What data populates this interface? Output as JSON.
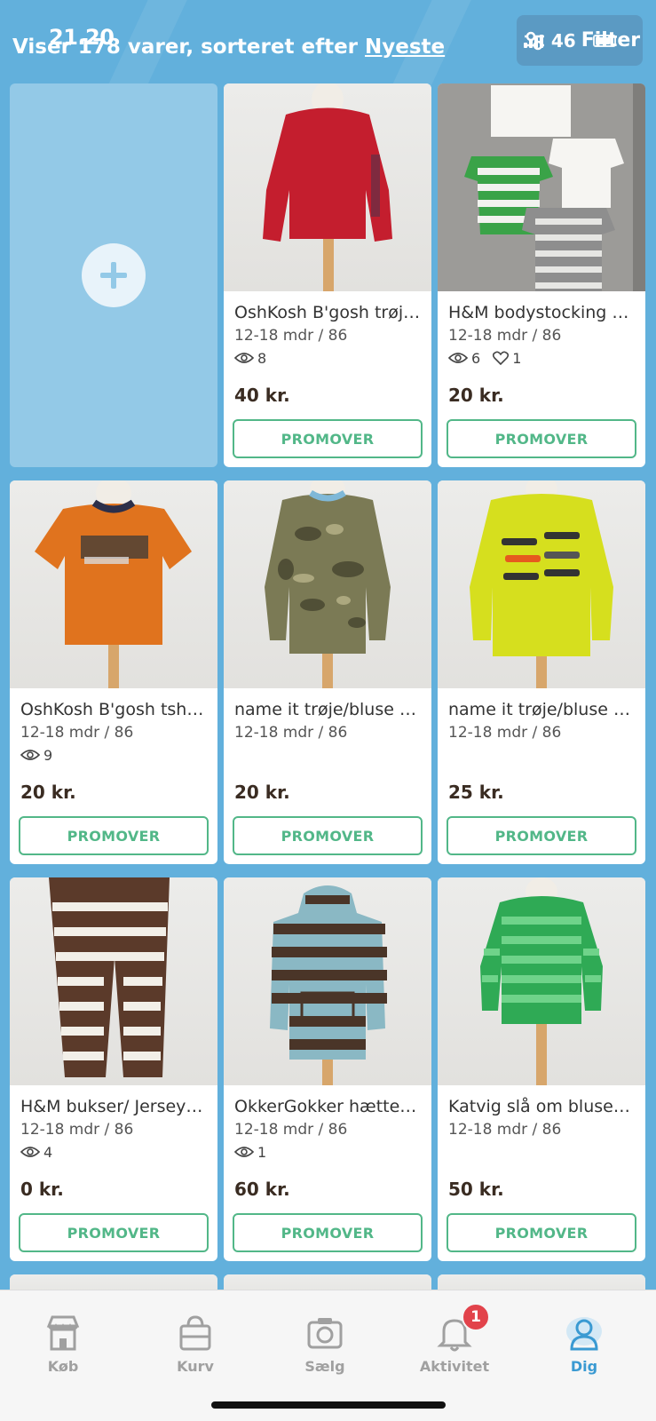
{
  "status_bar": {
    "time": "21.20",
    "battery": "46"
  },
  "header": {
    "prefix": "Viser 178 varer, sorteret efter ",
    "sort_label": "Nyeste",
    "filter_label": "Filter"
  },
  "add_card": {
    "icon": "plus-icon"
  },
  "items": [
    {
      "title": "OshKosh B'gosh trøje…",
      "size": "12-18 mdr / 86",
      "views": "8",
      "likes": "",
      "price": "40 kr.",
      "promote": "PROMOVER",
      "color": "#c41e2e"
    },
    {
      "title": "H&M bodystocking M…",
      "size": "12-18 mdr / 86",
      "views": "6",
      "likes": "1",
      "price": "20 kr.",
      "promote": "PROMOVER",
      "color": "#3aa348"
    },
    {
      "title": "OshKosh B'gosh tshir…",
      "size": "12-18 mdr / 86",
      "views": "9",
      "likes": "",
      "price": "20 kr.",
      "promote": "PROMOVER",
      "color": "#e0731e"
    },
    {
      "title": "name it trøje/bluse m…",
      "size": "12-18 mdr / 86",
      "views": "",
      "likes": "",
      "price": "20 kr.",
      "promote": "PROMOVER",
      "color": "#7b7a55"
    },
    {
      "title": "name it trøje/bluse m…",
      "size": "12-18 mdr / 86",
      "views": "",
      "likes": "",
      "price": "25 kr.",
      "promote": "PROMOVER",
      "color": "#d6df1e"
    },
    {
      "title": "H&M bukser/ Jersey…",
      "size": "12-18 mdr / 86",
      "views": "4",
      "likes": "",
      "price": "0 kr.",
      "promote": "PROMOVER",
      "color": "#5b3a2a"
    },
    {
      "title": "OkkerGokker hættetr…",
      "size": "12-18 mdr / 86",
      "views": "1",
      "likes": "",
      "price": "60 kr.",
      "promote": "PROMOVER",
      "color": "#8ab8c4"
    },
    {
      "title": "Katvig slå om bluse/tr…",
      "size": "12-18 mdr / 86",
      "views": "",
      "likes": "",
      "price": "50 kr.",
      "promote": "PROMOVER",
      "color": "#2faa55"
    }
  ],
  "tabs": [
    {
      "label": "Køb",
      "icon": "shop-icon"
    },
    {
      "label": "Kurv",
      "icon": "bag-icon"
    },
    {
      "label": "Sælg",
      "icon": "camera-icon"
    },
    {
      "label": "Aktivitet",
      "icon": "bell-icon",
      "badge": "1"
    },
    {
      "label": "Dig",
      "icon": "profile-icon"
    }
  ],
  "colors": {
    "accent": "#52b788",
    "background": "#62b0dc",
    "active_tab": "#3a9ad2",
    "badge": "#e2434b"
  }
}
